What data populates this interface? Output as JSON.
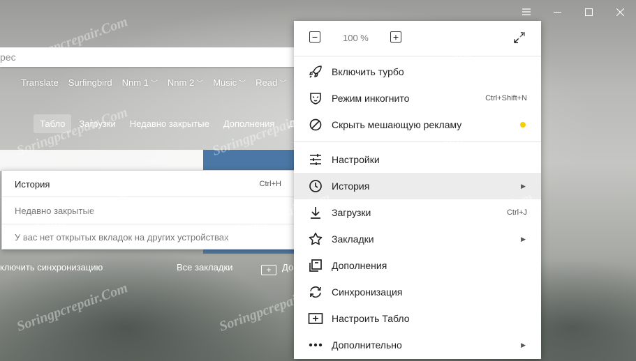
{
  "address_bar": {
    "placeholder_fragment": "рес"
  },
  "bookmarks": [
    {
      "label": "Translate",
      "has_dropdown": false
    },
    {
      "label": "Surfingbird",
      "has_dropdown": false
    },
    {
      "label": "Nnm 1",
      "has_dropdown": true
    },
    {
      "label": "Nnm 2",
      "has_dropdown": true
    },
    {
      "label": "Music",
      "has_dropdown": true
    },
    {
      "label": "Read",
      "has_dropdown": true
    }
  ],
  "tabs": [
    {
      "label": "Табло",
      "active": true
    },
    {
      "label": "Загрузки",
      "active": false
    },
    {
      "label": "Недавно закрытые",
      "active": false
    },
    {
      "label": "Дополнения",
      "active": false
    },
    {
      "label": "Д",
      "active": false
    }
  ],
  "bottom_row": {
    "sync_label": "ключить синхронизацию",
    "all_bookmarks_label": "Все закладки",
    "add_label": "До"
  },
  "history_submenu": {
    "history_label": "История",
    "history_shortcut": "Ctrl+H",
    "recently_closed_label": "Недавно закрытые",
    "no_tabs_label": "У вас нет открытых вкладок на других устройствах"
  },
  "main_menu": {
    "zoom": {
      "minus": "−",
      "value": "100 %",
      "plus": "+"
    },
    "section1": [
      {
        "label": "Включить турбо",
        "icon": "rocket-icon",
        "shortcut": ""
      },
      {
        "label": "Режим инкогнито",
        "icon": "incognito-mask-icon",
        "shortcut": "Ctrl+Shift+N"
      },
      {
        "label": "Скрыть мешающую рекламу",
        "icon": "block-ads-icon",
        "shortcut": ""
      }
    ],
    "section2": [
      {
        "label": "Настройки",
        "icon": "settings-sliders-icon",
        "shortcut": "",
        "submenu": false
      },
      {
        "label": "История",
        "icon": "clock-icon",
        "shortcut": "",
        "submenu": true
      },
      {
        "label": "Загрузки",
        "icon": "download-arrow-icon",
        "shortcut": "Ctrl+J",
        "submenu": false
      },
      {
        "label": "Закладки",
        "icon": "star-icon",
        "shortcut": "",
        "submenu": true
      },
      {
        "label": "Дополнения",
        "icon": "extensions-icon",
        "shortcut": "",
        "submenu": false
      },
      {
        "label": "Синхронизация",
        "icon": "sync-arrows-icon",
        "shortcut": "",
        "submenu": false
      },
      {
        "label": "Настроить Табло",
        "icon": "add-tile-icon",
        "shortcut": "",
        "submenu": false
      },
      {
        "label": "Дополнительно",
        "icon": "more-dots-icon",
        "shortcut": "",
        "submenu": true
      }
    ],
    "ads_indicator_color": "#f5d000"
  },
  "watermark": {
    "text": "Soringpcrepair.Com"
  },
  "colors": {
    "accent_blue": "#4a77a5",
    "highlight": "#ececec"
  }
}
